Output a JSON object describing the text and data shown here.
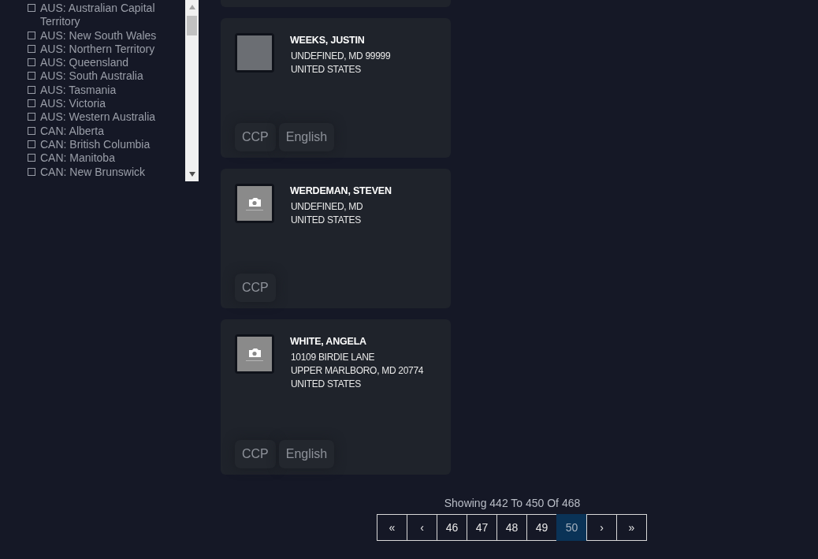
{
  "filters": [
    {
      "label": "AUS: Australian Capital Territory",
      "checked": false
    },
    {
      "label": "AUS: New South Wales",
      "checked": false
    },
    {
      "label": "AUS: Northern Territory",
      "checked": false
    },
    {
      "label": "AUS: Queensland",
      "checked": false
    },
    {
      "label": "AUS: South Australia",
      "checked": false
    },
    {
      "label": "AUS: Tasmania",
      "checked": false
    },
    {
      "label": "AUS: Victoria",
      "checked": false
    },
    {
      "label": "AUS: Western Australia",
      "checked": false
    },
    {
      "label": "CAN: Alberta",
      "checked": false
    },
    {
      "label": "CAN: British Columbia",
      "checked": false
    },
    {
      "label": "CAN: Manitoba",
      "checked": false
    },
    {
      "label": "CAN: New Brunswick",
      "checked": false
    }
  ],
  "cards": [
    {
      "kind": "person",
      "name": "WEEKS, JUSTIN",
      "address": [
        "UNDEFINED, MD 99999",
        "UNITED STATES"
      ],
      "tags": [
        "CCP",
        "English"
      ]
    },
    {
      "kind": "unavailable",
      "name": "WERDEMAN, STEVEN",
      "address": [
        "UNDEFINED, MD",
        "UNITED STATES"
      ],
      "tags": [
        "CCP"
      ]
    },
    {
      "kind": "unavailable",
      "name": "WHITE, ANGELA",
      "address": [
        "10109 BIRDIE LANE",
        "UPPER MARLBORO, MD 20774",
        "UNITED STATES"
      ],
      "tags": [
        "CCP",
        "English"
      ]
    }
  ],
  "pagination": {
    "summary": "Showing 442 To 450 Of 468",
    "first": "«",
    "prev": "‹",
    "pages": [
      {
        "label": "46",
        "selected": false
      },
      {
        "label": "47",
        "selected": false
      },
      {
        "label": "48",
        "selected": false
      },
      {
        "label": "49",
        "selected": false
      },
      {
        "label": "50",
        "selected": true
      }
    ],
    "next": "›",
    "last": "»"
  }
}
